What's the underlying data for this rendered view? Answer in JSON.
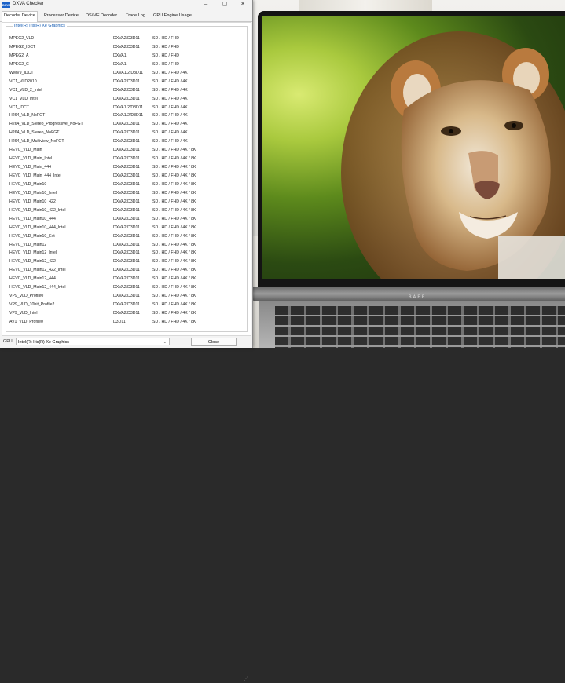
{
  "window": {
    "title": "DXVA Checker",
    "icon_text": "DXVA",
    "minimize": "–",
    "maximize": "▢",
    "close": "✕"
  },
  "tabs": [
    "Decoder Device",
    "Processor Device",
    "DS/MF Decoder",
    "Trace Log",
    "GPU Engine Usage"
  ],
  "active_tab": "Decoder Device",
  "gpu_group_title": "Intel(R) Iris(R) Xe Graphics",
  "decoders": [
    {
      "name": "MPEG2_VLD",
      "api": "DXVA2/D3D11",
      "res": "SD / HD / FHD"
    },
    {
      "name": "MPEG2_IDCT",
      "api": "DXVA2/D3D11",
      "res": "SD / HD / FHD"
    },
    {
      "name": "MPEG2_A",
      "api": "DXVA1",
      "res": "SD / HD / FHD"
    },
    {
      "name": "MPEG2_C",
      "api": "DXVA1",
      "res": "SD / HD / FHD"
    },
    {
      "name": "WMV9_IDCT",
      "api": "DXVA1/2/D3D11",
      "res": "SD / HD / FHD / 4K"
    },
    {
      "name": "VC1_VLD2010",
      "api": "DXVA2/D3D11",
      "res": "SD / HD / FHD / 4K"
    },
    {
      "name": "VC1_VLD_2_Intel",
      "api": "DXVA2/D3D11",
      "res": "SD / HD / FHD / 4K"
    },
    {
      "name": "VC1_VLD_Intel",
      "api": "DXVA2/D3D11",
      "res": "SD / HD / FHD / 4K"
    },
    {
      "name": "VC1_IDCT",
      "api": "DXVA1/2/D3D11",
      "res": "SD / HD / FHD / 4K"
    },
    {
      "name": "H264_VLD_NoFGT",
      "api": "DXVA1/2/D3D11",
      "res": "SD / HD / FHD / 4K"
    },
    {
      "name": "H264_VLD_Stereo_Progressive_NoFGT",
      "api": "DXVA2/D3D11",
      "res": "SD / HD / FHD / 4K"
    },
    {
      "name": "H264_VLD_Stereo_NoFGT",
      "api": "DXVA2/D3D11",
      "res": "SD / HD / FHD / 4K"
    },
    {
      "name": "H264_VLD_Multiview_NoFGT",
      "api": "DXVA2/D3D11",
      "res": "SD / HD / FHD / 4K"
    },
    {
      "name": "HEVC_VLD_Main",
      "api": "DXVA2/D3D11",
      "res": "SD / HD / FHD / 4K / 8K"
    },
    {
      "name": "HEVC_VLD_Main_Intel",
      "api": "DXVA2/D3D11",
      "res": "SD / HD / FHD / 4K / 8K"
    },
    {
      "name": "HEVC_VLD_Main_444",
      "api": "DXVA2/D3D11",
      "res": "SD / HD / FHD / 4K / 8K"
    },
    {
      "name": "HEVC_VLD_Main_444_Intel",
      "api": "DXVA2/D3D11",
      "res": "SD / HD / FHD / 4K / 8K"
    },
    {
      "name": "HEVC_VLD_Main10",
      "api": "DXVA2/D3D11",
      "res": "SD / HD / FHD / 4K / 8K"
    },
    {
      "name": "HEVC_VLD_Main10_Intel",
      "api": "DXVA2/D3D11",
      "res": "SD / HD / FHD / 4K / 8K"
    },
    {
      "name": "HEVC_VLD_Main10_422",
      "api": "DXVA2/D3D11",
      "res": "SD / HD / FHD / 4K / 8K"
    },
    {
      "name": "HEVC_VLD_Main10_422_Intel",
      "api": "DXVA2/D3D11",
      "res": "SD / HD / FHD / 4K / 8K"
    },
    {
      "name": "HEVC_VLD_Main10_444",
      "api": "DXVA2/D3D11",
      "res": "SD / HD / FHD / 4K / 8K"
    },
    {
      "name": "HEVC_VLD_Main10_444_Intel",
      "api": "DXVA2/D3D11",
      "res": "SD / HD / FHD / 4K / 8K"
    },
    {
      "name": "HEVC_VLD_Main10_Ext",
      "api": "DXVA2/D3D11",
      "res": "SD / HD / FHD / 4K / 8K"
    },
    {
      "name": "HEVC_VLD_Main12",
      "api": "DXVA2/D3D11",
      "res": "SD / HD / FHD / 4K / 8K"
    },
    {
      "name": "HEVC_VLD_Main12_Intel",
      "api": "DXVA2/D3D11",
      "res": "SD / HD / FHD / 4K / 8K"
    },
    {
      "name": "HEVC_VLD_Main12_422",
      "api": "DXVA2/D3D11",
      "res": "SD / HD / FHD / 4K / 8K"
    },
    {
      "name": "HEVC_VLD_Main12_422_Intel",
      "api": "DXVA2/D3D11",
      "res": "SD / HD / FHD / 4K / 8K"
    },
    {
      "name": "HEVC_VLD_Main12_444",
      "api": "DXVA2/D3D11",
      "res": "SD / HD / FHD / 4K / 8K"
    },
    {
      "name": "HEVC_VLD_Main12_444_Intel",
      "api": "DXVA2/D3D11",
      "res": "SD / HD / FHD / 4K / 8K"
    },
    {
      "name": "VP9_VLD_Profile0",
      "api": "DXVA2/D3D11",
      "res": "SD / HD / FHD / 4K / 8K"
    },
    {
      "name": "VP9_VLD_10bit_Profile2",
      "api": "DXVA2/D3D11",
      "res": "SD / HD / FHD / 4K / 8K"
    },
    {
      "name": "VP9_VLD_Intel",
      "api": "DXVA2/D3D11",
      "res": "SD / HD / FHD / 4K / 8K"
    },
    {
      "name": "AV1_VLD_Profile0",
      "api": "D3D11",
      "res": "SD / HD / FHD / 4K / 8K"
    }
  ],
  "status": {
    "gpu_label": "GPU:",
    "gpu_value": "Intel(R) Iris(R) Xe Graphics",
    "close_label": "Close"
  },
  "laptop_brand": "BAER",
  "colors": {
    "accent": "#1c63c9",
    "group_title": "#1a5fb4"
  }
}
